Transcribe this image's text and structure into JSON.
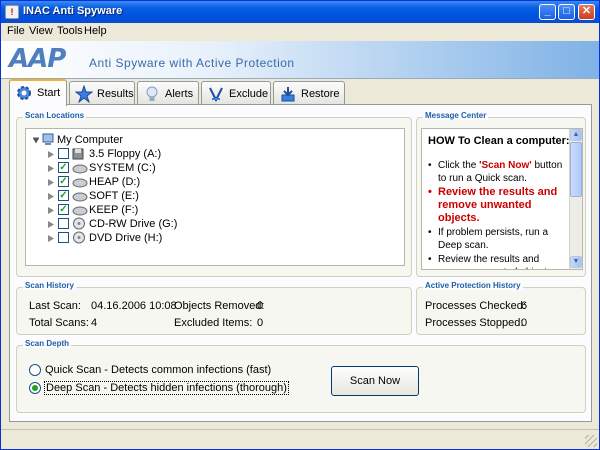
{
  "window": {
    "title": "INAC Anti Spyware",
    "title_icon": "app-icon",
    "min_symbol": "_",
    "max_symbol": "□",
    "close_symbol": "✕"
  },
  "menu": {
    "items": [
      "File",
      "View",
      "Tools",
      "Help"
    ]
  },
  "banner": {
    "logo_text": "AAP",
    "tagline": "Anti Spyware with Active Protection"
  },
  "tabs": [
    {
      "label": "Start",
      "icon": "gear-icon",
      "active": true
    },
    {
      "label": "Results",
      "icon": "star-icon",
      "active": false
    },
    {
      "label": "Alerts",
      "icon": "lightbulb-icon",
      "active": false
    },
    {
      "label": "Exclude",
      "icon": "exclude-icon",
      "active": false
    },
    {
      "label": "Restore",
      "icon": "restore-icon",
      "active": false
    }
  ],
  "scan_locations": {
    "title": "Scan Locations",
    "root": "My Computer",
    "items": [
      {
        "label": "3.5 Floppy (A:)",
        "checked": false,
        "type": "floppy"
      },
      {
        "label": "SYSTEM (C:)",
        "checked": true,
        "type": "hdd"
      },
      {
        "label": "HEAP (D:)",
        "checked": true,
        "type": "hdd"
      },
      {
        "label": "SOFT (E:)",
        "checked": true,
        "type": "hdd"
      },
      {
        "label": "KEEP (F:)",
        "checked": true,
        "type": "hdd"
      },
      {
        "label": "CD-RW Drive (G:)",
        "checked": false,
        "type": "cd"
      },
      {
        "label": "DVD Drive (H:)",
        "checked": false,
        "type": "cd"
      }
    ]
  },
  "message_center": {
    "title": "Message Center",
    "heading": "HOW To Clean a computer:",
    "line1_pre": "Click the ",
    "line1_link": "'Scan Now'",
    "line1_post": " button to run a Quick scan.",
    "line2": "Review the results and remove unwanted objects.",
    "line3": "If problem persists, run a Deep scan.",
    "line4": "Review the results and remove unwanted objects."
  },
  "scan_history": {
    "title": "Scan History",
    "last_scan_label": "Last Scan:",
    "last_scan_value": "04.16.2006 10:08",
    "total_scans_label": "Total Scans:",
    "total_scans_value": "4",
    "objects_removed_label": "Objects Removed:",
    "objects_removed_value": "0",
    "excluded_items_label": "Excluded Items:",
    "excluded_items_value": "0"
  },
  "protection_history": {
    "title": "Active Protection History",
    "processes_checked_label": "Processes Checked:",
    "processes_checked_value": "6",
    "processes_stopped_label": "Processes Stopped:",
    "processes_stopped_value": "0"
  },
  "scan_depth": {
    "title": "Scan Depth",
    "quick_label": "Quick Scan - Detects common infections (fast)",
    "deep_label": "Deep Scan - Detects hidden infections (thorough)",
    "selected": "deep",
    "scan_button": "Scan Now"
  }
}
